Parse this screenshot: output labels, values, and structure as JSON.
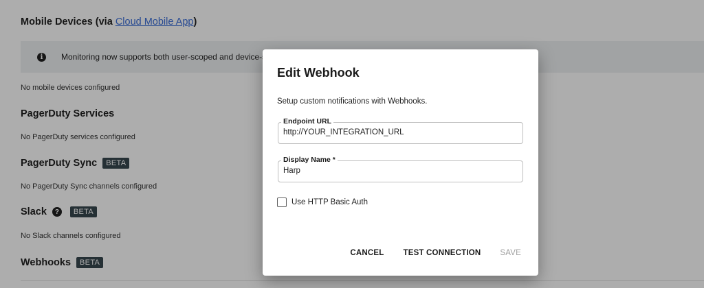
{
  "mobile": {
    "title": "Mobile Devices (via ",
    "link": "Cloud Mobile App",
    "title_suffix": ")",
    "empty": "No mobile devices configured"
  },
  "banner": {
    "icon": "info-icon",
    "text": "Monitoring now supports both user-scoped and device-sc"
  },
  "pagerduty_services": {
    "title": "PagerDuty Services",
    "empty": "No PagerDuty services configured"
  },
  "pagerduty_sync": {
    "title": "PagerDuty Sync",
    "badge": "BETA",
    "empty": "No PagerDuty Sync channels configured"
  },
  "slack": {
    "title": "Slack",
    "help_icon": "?",
    "badge": "BETA",
    "empty": "No Slack channels configured"
  },
  "webhooks": {
    "title": "Webhooks",
    "badge": "BETA"
  },
  "dialog": {
    "title": "Edit Webhook",
    "description": "Setup custom notifications with Webhooks.",
    "endpoint_label": "Endpoint URL",
    "endpoint_value": "http://YOUR_INTEGRATION_URL",
    "display_name_label": "Display Name *",
    "display_name_value": "Harp",
    "basic_auth_label": "Use HTTP Basic Auth",
    "basic_auth_checked": false,
    "cancel": "CANCEL",
    "test": "TEST CONNECTION",
    "save": "SAVE"
  },
  "colors": {
    "link": "#3d6fd8",
    "badge_bg": "#37474f",
    "banner_bg": "#eef0f2",
    "disabled": "#9e9e9e"
  }
}
